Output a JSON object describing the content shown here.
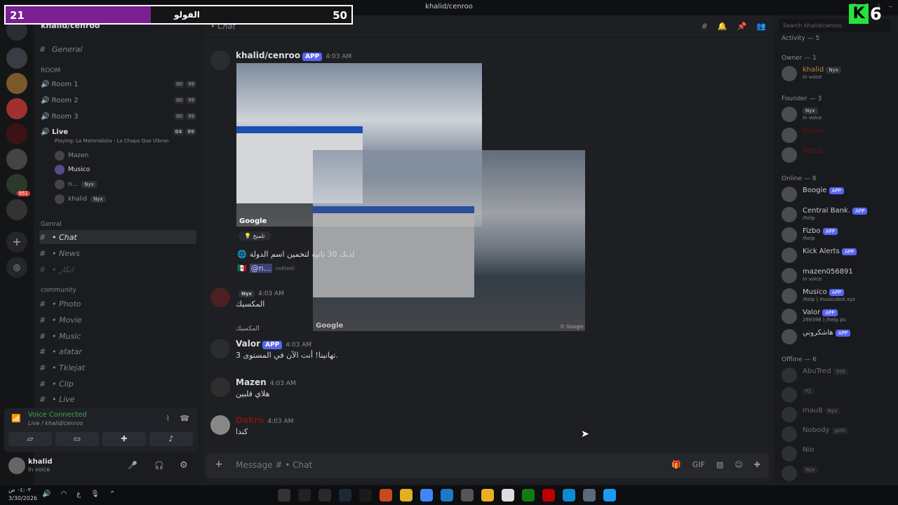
{
  "window": {
    "title": "khalid/cenroo"
  },
  "overlay": {
    "left_score": "21",
    "title": "الفولو",
    "right_score": "50",
    "fill_fraction": 0.42,
    "badge_letter": "K",
    "badge_number": "6"
  },
  "server": {
    "name": "khalid/cenroo"
  },
  "channels": {
    "general": "General",
    "room_cat": "ROOM",
    "rooms": [
      {
        "name": "Room 1",
        "a": "00",
        "b": "99"
      },
      {
        "name": "Room 2",
        "a": "00",
        "b": "99"
      },
      {
        "name": "Room 3",
        "a": "00",
        "b": "99"
      },
      {
        "name": "Live",
        "a": "04",
        "b": "99"
      }
    ],
    "live_status": "Playing: La Materialista - La Chapa Que Vibran",
    "voice_users": [
      {
        "name": "Mazen",
        "tag": ""
      },
      {
        "name": "Musico",
        "tag": ""
      },
      {
        "name": "n...",
        "tag": "Nyx"
      },
      {
        "name": "khalid",
        "tag": "Nyx"
      }
    ],
    "genral_cat": "Genral",
    "chat": "• Chat",
    "news": "• News",
    "hidden": "• اتكار",
    "community_cat": "community",
    "community": [
      "• Photo",
      "• Movie",
      "• Music",
      "• afatar",
      "• Tklejat",
      "• Clip",
      "• Live"
    ]
  },
  "voice": {
    "status": "Voice Connected",
    "channel": "Live / khalid/cenroo"
  },
  "user": {
    "name": "khalid",
    "status": "In voice"
  },
  "chat_header": {
    "title": "• Chat",
    "search": "Search khalid/cenroo"
  },
  "messages": [
    {
      "author": "khalid/cenroo",
      "app": "APP",
      "time": "4:03 AM",
      "hint": "تلميح",
      "text": "لديك 30 ثانية لتخمين اسم الدولة",
      "mention": "@n...",
      "edited": "(edited)",
      "google": "Google",
      "google_copy": "© Google"
    },
    {
      "author": "",
      "tag": "Nyx",
      "time": "4:03 AM",
      "text": "المكسيك"
    },
    {
      "reply": "المكسيك",
      "author": "Valor",
      "app": "APP",
      "time": "4:03 AM",
      "text": "تهانينا! أنت الآن في المستوى 3."
    },
    {
      "author": "Mazen",
      "time": "4:03 AM",
      "text": "هلاي فلبين"
    },
    {
      "author": "Dokro",
      "time": "4:03 AM",
      "text": "كندا"
    }
  ],
  "composer": {
    "placeholder": "Message # • Chat"
  },
  "members": {
    "activity": "Activity — 5",
    "owner_head": "Owner — 1",
    "owner": [
      {
        "name": "khalid",
        "tag": "Nyx",
        "status": "In voice"
      }
    ],
    "founder_head": "Founder — 3",
    "founder": [
      {
        "name": "",
        "tag": "Nyx",
        "status": "In voice"
      },
      {
        "name": "Dokro",
        "tag": "",
        "status": ""
      },
      {
        "name": "Teeza",
        "tag": "",
        "status": ""
      }
    ],
    "online_head": "Online — 8",
    "online": [
      {
        "name": "Boogie",
        "app": "APP",
        "status": ""
      },
      {
        "name": "Central Bank.",
        "app": "APP",
        "status": "/help"
      },
      {
        "name": "Fizbo",
        "app": "APP",
        "status": "/help"
      },
      {
        "name": "Kick Alerts",
        "app": "APP",
        "status": ""
      },
      {
        "name": "mazen056891",
        "app": "",
        "status": "In voice"
      },
      {
        "name": "Musico",
        "app": "APP",
        "status": "/help | musicobot.xyz"
      },
      {
        "name": "Valor",
        "app": "APP",
        "status": "269398 | /help ps"
      },
      {
        "name": "هاشكروني",
        "app": "APP",
        "status": ""
      }
    ],
    "offline_head": "Offline — 6",
    "offline": [
      {
        "name": "AbuTred",
        "tag": "505"
      },
      {
        "name": "",
        "tag": "F1"
      },
      {
        "name": "mau8",
        "tag": "Nyx"
      },
      {
        "name": "Nobody",
        "tag": "goth"
      },
      {
        "name": "Nio",
        "tag": ""
      },
      {
        "name": "",
        "tag": "Nyx"
      }
    ]
  },
  "taskbar": {
    "time": "٠٤:٠٣ ص",
    "date": "3/30/2026",
    "lang": "ع"
  }
}
